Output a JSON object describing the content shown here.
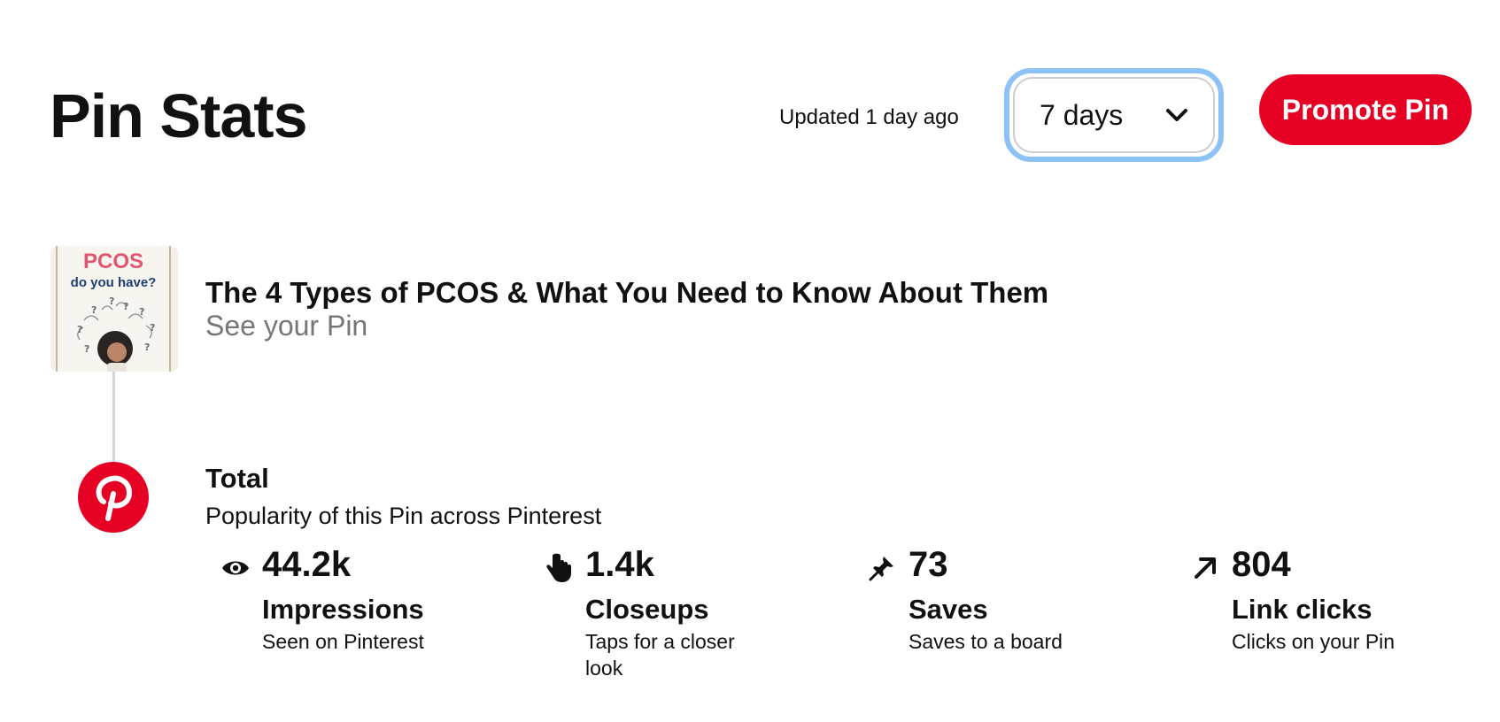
{
  "header": {
    "title": "Pin Stats",
    "updated": "Updated 1 day ago",
    "range_select": "7 days",
    "promote_label": "Promote Pin"
  },
  "pin": {
    "thumbnail_text": "PCOS",
    "thumbnail_subtext": "do you have?",
    "title": "The 4 Types of PCOS & What You Need to Know About Them",
    "link": "See your Pin"
  },
  "total": {
    "label": "Total",
    "description": "Popularity of this Pin across Pinterest"
  },
  "metrics": [
    {
      "icon": "eye-icon",
      "value": "44.2k",
      "name": "Impressions",
      "desc": "Seen on Pinterest"
    },
    {
      "icon": "tap-hand-icon",
      "value": "1.4k",
      "name": "Closeups",
      "desc": "Taps for a closer look"
    },
    {
      "icon": "pin-icon",
      "value": "73",
      "name": "Saves",
      "desc": "Saves to a board"
    },
    {
      "icon": "arrow-up-right-icon",
      "value": "804",
      "name": "Link clicks",
      "desc": "Clicks on your Pin"
    }
  ],
  "colors": {
    "brand": "#e60023",
    "focus_ring": "#8cc2f6",
    "muted_text": "#767676"
  }
}
